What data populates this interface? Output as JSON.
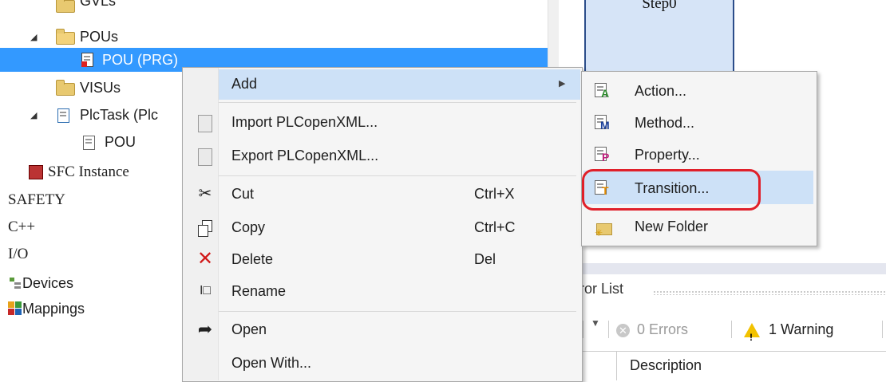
{
  "tree": {
    "gvls_label": "GVLs",
    "pous_label": "POUs",
    "pou_prg_label": "POU (PRG)",
    "visus_label": "VISUs",
    "plctask_label": "PlcTask (Plc",
    "pou_label": "POU",
    "sfc_instance_label": "SFC Instance",
    "safety_label": "SAFETY",
    "cpp_label": "C++",
    "io_label": "I/O",
    "devices_label": "Devices",
    "mappings_label": "Mappings"
  },
  "editor": {
    "step_label": "Step0"
  },
  "error_list": {
    "title": "ror List",
    "errors_label": "0 Errors",
    "warning_label": "1 Warning",
    "description_header": "Description"
  },
  "context_menu": {
    "items": [
      {
        "label": "Add",
        "shortcut": "",
        "icon": "none",
        "has_submenu": true
      },
      {
        "label": "Import PLCopenXML...",
        "shortcut": "",
        "icon": "import-icon"
      },
      {
        "label": "Export PLCopenXML...",
        "shortcut": "",
        "icon": "export-icon"
      },
      {
        "label": "Cut",
        "shortcut": "Ctrl+X",
        "icon": "scissors-icon"
      },
      {
        "label": "Copy",
        "shortcut": "Ctrl+C",
        "icon": "copy-icon"
      },
      {
        "label": "Delete",
        "shortcut": "Del",
        "icon": "delete-icon"
      },
      {
        "label": "Rename",
        "shortcut": "",
        "icon": "rename-icon"
      },
      {
        "label": "Open",
        "shortcut": "",
        "icon": "open-arrow-icon"
      },
      {
        "label": "Open With...",
        "shortcut": "",
        "icon": "none"
      }
    ]
  },
  "submenu": {
    "items": [
      {
        "label": "Action...",
        "icon": "action-icon"
      },
      {
        "label": "Method...",
        "icon": "method-icon"
      },
      {
        "label": "Property...",
        "icon": "property-icon"
      },
      {
        "label": "Transition...",
        "icon": "transition-icon",
        "highlighted": true
      },
      {
        "label": "New Folder",
        "icon": "new-folder-icon"
      }
    ]
  },
  "colors": {
    "selection": "#3399ff",
    "menu_highlight": "#cde1f7",
    "annotation_circle": "#e0202a",
    "delete_x": "#d11919",
    "warning": "#f2c200"
  }
}
